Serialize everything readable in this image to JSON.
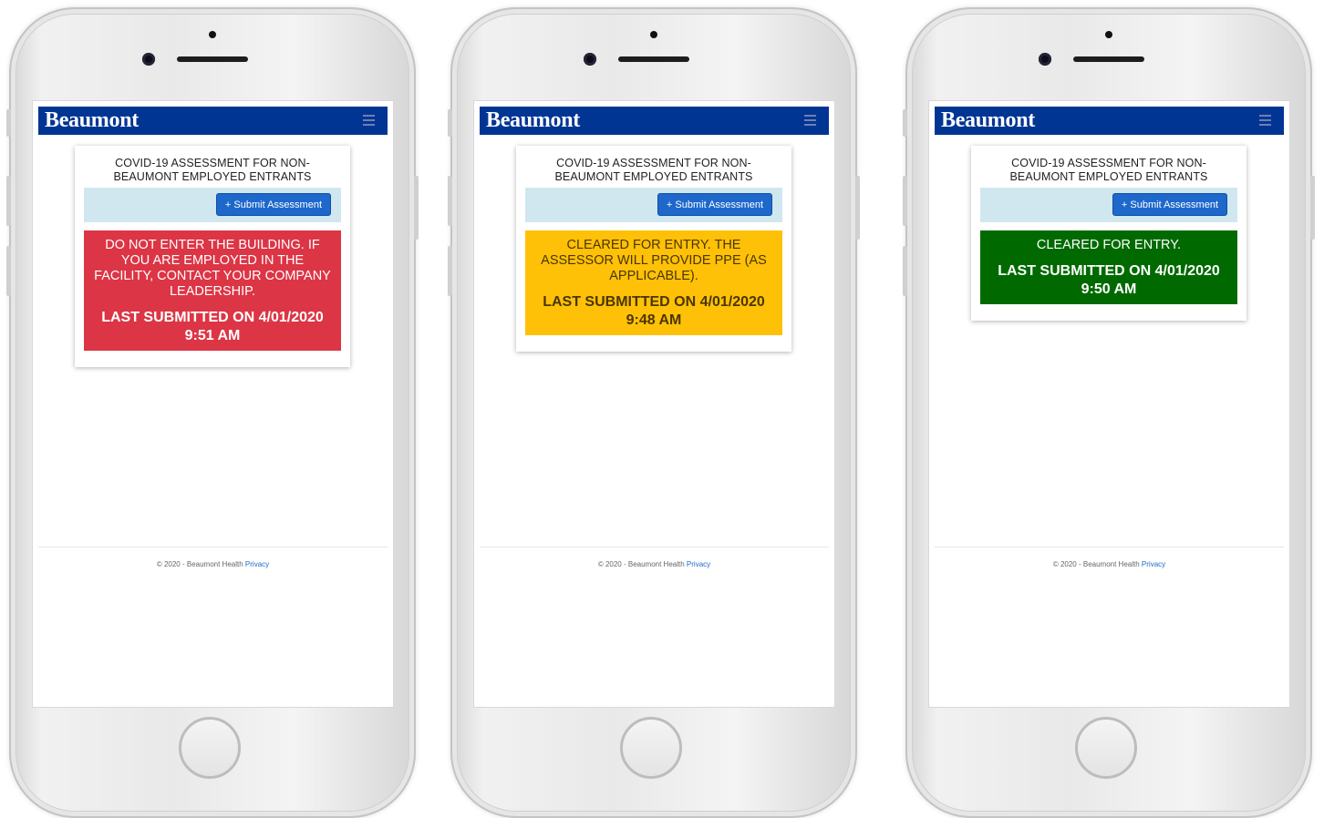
{
  "phones": [
    {
      "brand": "Beaumont",
      "card_title": "COVID-19 ASSESSMENT FOR NON-BEAUMONT EMPLOYED ENTRANTS",
      "submit_label": "+ Submit Assessment",
      "status_color": "#dc3545",
      "status_message": "DO NOT ENTER THE BUILDING. IF YOU ARE EMPLOYED IN THE FACILITY, CONTACT YOUR COMPANY LEADERSHIP.",
      "last_submitted": "LAST SUBMITTED ON 4/01/2020 9:51 AM",
      "footer_text": "© 2020 - Beaumont Health",
      "footer_link": "Privacy"
    },
    {
      "brand": "Beaumont",
      "card_title": "COVID-19 ASSESSMENT FOR NON-BEAUMONT EMPLOYED ENTRANTS",
      "submit_label": "+ Submit Assessment",
      "status_color": "#ffc107",
      "status_message": "CLEARED FOR ENTRY. THE ASSESSOR WILL PROVIDE PPE (AS APPLICABLE).",
      "last_submitted": "LAST SUBMITTED ON 4/01/2020 9:48 AM",
      "footer_text": "© 2020 - Beaumont Health",
      "footer_link": "Privacy"
    },
    {
      "brand": "Beaumont",
      "card_title": "COVID-19 ASSESSMENT FOR NON-BEAUMONT EMPLOYED ENTRANTS",
      "submit_label": "+ Submit Assessment",
      "status_color": "#006a00",
      "status_message": "CLEARED FOR ENTRY.",
      "last_submitted": "LAST SUBMITTED ON 4/01/2020 9:50 AM",
      "footer_text": "© 2020 - Beaumont Health",
      "footer_link": "Privacy"
    }
  ],
  "colors": {
    "navbar": "#003594",
    "button": "#1e68cb",
    "action_bar": "#d0e7f0"
  }
}
